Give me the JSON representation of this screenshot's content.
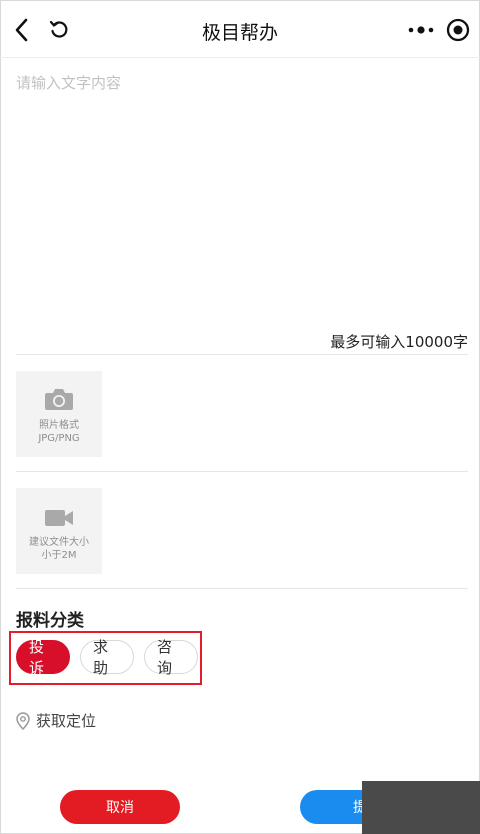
{
  "header": {
    "title": "极目帮办"
  },
  "editor": {
    "placeholder": "请输入文字内容",
    "value": "",
    "counter": "最多可输入10000字"
  },
  "uploads": [
    {
      "icon": "camera-icon",
      "caption_line1": "照片格式",
      "caption_line2": "JPG/PNG"
    },
    {
      "icon": "video-camera-icon",
      "caption_line1": "建议文件大小",
      "caption_line2": "小于2M"
    }
  ],
  "category": {
    "title": "报料分类",
    "options": [
      "投诉",
      "求助",
      "咨询"
    ],
    "selected": "投诉"
  },
  "location": {
    "label": "获取定位"
  },
  "buttons": {
    "cancel": "取消",
    "submit": "提"
  },
  "colors": {
    "accent_red": "#d70f2a",
    "submit_blue": "#1a8cf0",
    "highlight_box": "#e31d2b"
  }
}
